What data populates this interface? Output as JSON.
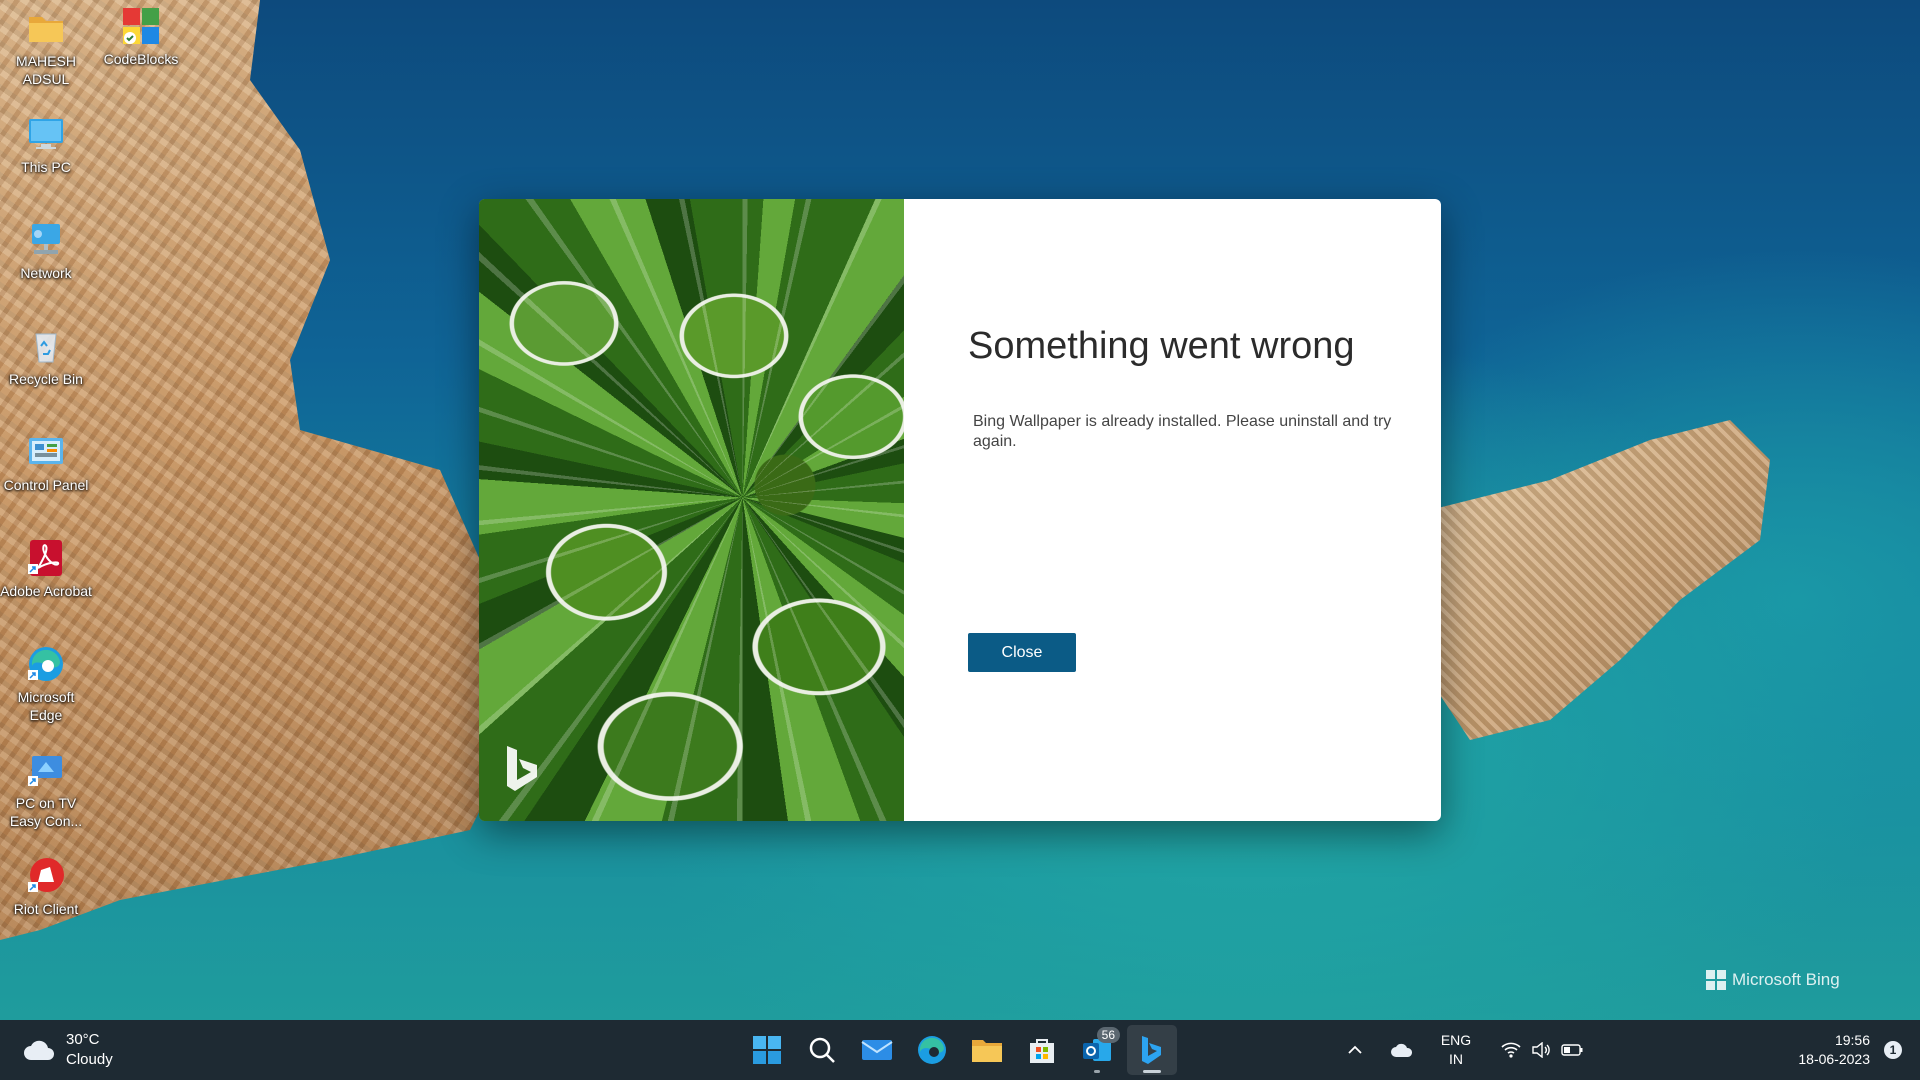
{
  "desktop": {
    "icons": [
      {
        "label": "MAHESH ADSUL",
        "icon": "folder-icon"
      },
      {
        "label": "CodeBlocks",
        "icon": "codeblocks-icon"
      },
      {
        "label": "This PC",
        "icon": "monitor-icon"
      },
      {
        "label": "Network",
        "icon": "network-icon"
      },
      {
        "label": "Recycle Bin",
        "icon": "recycle-bin-icon"
      },
      {
        "label": "Control Panel",
        "icon": "control-panel-icon"
      },
      {
        "label": "Adobe Acrobat",
        "icon": "adobe-acrobat-icon"
      },
      {
        "label": "Microsoft Edge",
        "icon": "edge-icon"
      },
      {
        "label": "PC on TV Easy Con...",
        "icon": "pc-on-tv-icon"
      },
      {
        "label": "Riot Client",
        "icon": "riot-client-icon"
      }
    ],
    "watermark": "Microsoft Bing"
  },
  "dialog": {
    "title": "Something went wrong",
    "message": "Bing Wallpaper is already installed. Please uninstall and try again.",
    "close_label": "Close",
    "accent": "#0b5b86"
  },
  "taskbar": {
    "weather": {
      "temp": "30°C",
      "condition": "Cloudy"
    },
    "apps": [
      {
        "name": "start",
        "icon": "windows-start-icon"
      },
      {
        "name": "search",
        "icon": "search-icon"
      },
      {
        "name": "mail",
        "icon": "mail-icon"
      },
      {
        "name": "edge",
        "icon": "edge-icon"
      },
      {
        "name": "file-explorer",
        "icon": "folder-icon"
      },
      {
        "name": "microsoft-store",
        "icon": "store-icon"
      },
      {
        "name": "outlook",
        "icon": "outlook-icon",
        "badge": "56"
      },
      {
        "name": "bing-wallpaper",
        "icon": "bing-icon"
      }
    ],
    "tray": {
      "language": "ENG",
      "region": "IN",
      "time": "19:56",
      "date": "18-06-2023",
      "notification_count": "1"
    }
  }
}
